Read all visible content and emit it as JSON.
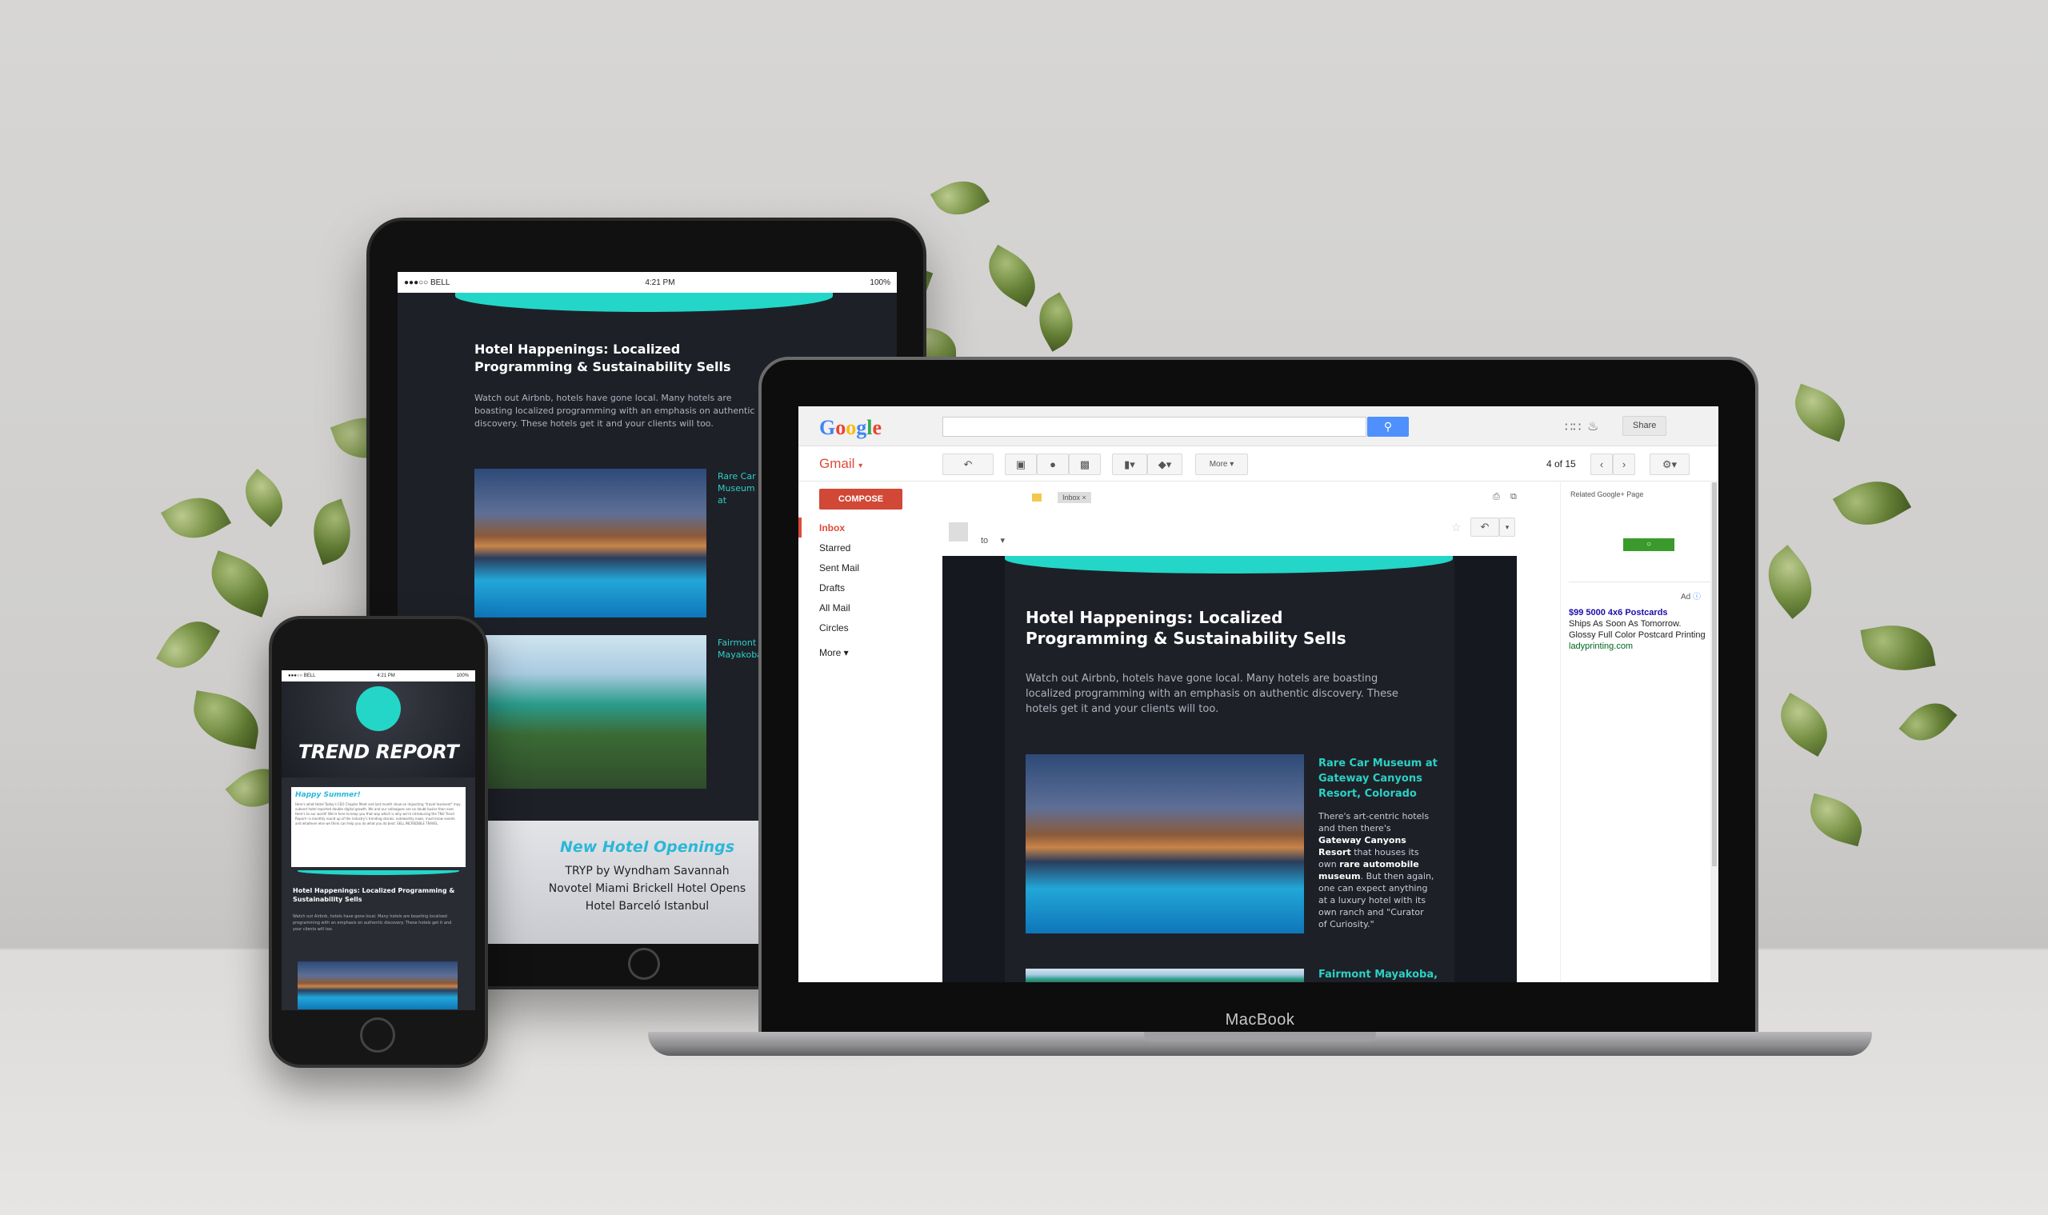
{
  "laptop": {
    "brand_label": "MacBook",
    "gmail": {
      "logo": "Google",
      "search_icon": "search-icon",
      "share_label": "Share",
      "app_label": "Gmail",
      "compose_label": "COMPOSE",
      "nav": [
        {
          "label": "Inbox",
          "active": true
        },
        {
          "label": "Starred"
        },
        {
          "label": "Sent Mail"
        },
        {
          "label": "Drafts"
        },
        {
          "label": "All Mail"
        },
        {
          "label": "Circles"
        },
        {
          "label": "More"
        }
      ],
      "more_label": "More",
      "pagination": "4 of 15",
      "label_chip": "Inbox",
      "to_label": "to",
      "right_panel": {
        "title": "Related Google+ Page",
        "ad_label": "Ad",
        "ad_title": "$99 5000 4x6 Postcards",
        "ad_line1": "Ships As Soon As Tomorrow.",
        "ad_line2": "Glossy Full Color Postcard Printing",
        "ad_url": "ladyprinting.com"
      }
    },
    "email": {
      "headline": "Hotel Happenings: Localized Programming & Sustainability Sells",
      "intro": "Watch out Airbnb, hotels have gone local. Many hotels are boasting localized programming with an emphasis on authentic discovery. These hotels get it and your clients will too.",
      "item1_title": "Rare Car Museum at Gateway Canyons Resort, Colorado",
      "item1_body_a": "There's art-centric hotels and then there's ",
      "item1_body_b": "Gateway Canyons Resort",
      "item1_body_c": " that houses its own ",
      "item1_body_d": "rare automobile museum",
      "item1_body_e": ". But then again, one can expect anything at a luxury hotel with its own ranch and \"Curator of Curiosity.\"",
      "item2_title": "Fairmont Mayakoba,"
    }
  },
  "tablet": {
    "status_left": "●●●○○ BELL",
    "status_time": "4:21 PM",
    "status_right": "100%",
    "headline": "Hotel Happenings: Localized Programming & Sustainability Sells",
    "intro": "Watch out Airbnb, hotels have gone local. Many hotels are boasting localized programming with an emphasis on authentic discovery. These hotels get it and your clients will too.",
    "item1_title": "Rare Car Museum at Gateway Canyons Resort,",
    "item2_title": "Fairmont Mayakoba, Riviera",
    "openings_title": "New Hotel Openings",
    "openings": [
      "TRYP by Wyndham Savannah",
      "Novotel Miami Brickell Hotel Opens",
      "Hotel Barceló Istanbul"
    ]
  },
  "phone": {
    "status_left": "●●●○○ BELL",
    "status_time": "4:21 PM",
    "status_right": "100%",
    "banner": "TREND REPORT",
    "greeting": "Happy Summer!",
    "greeting_body": "Here's what Hotel Today's CEO Chapter Meet and last month show on impacting \"travel Insolvent\" may subvert hotel reported double digital growth. We and our colleagues are no doubt busier than ever. Here's to our world! We're here to keep you that way which is why we're introducing the TNU Trend Report—a monthly round up of the industry's trending stories, noteworthy news, must-know events and whatever else we think can help you do what you do best: SELL INCREDIBLE TRAVEL.",
    "headline": "Hotel Happenings: Localized Programming & Sustainability Sells",
    "intro": "Watch out Airbnb, hotels have gone local. Many hotels are boasting localized programming with an emphasis on authentic discovery. These hotels get it and your clients will too."
  }
}
